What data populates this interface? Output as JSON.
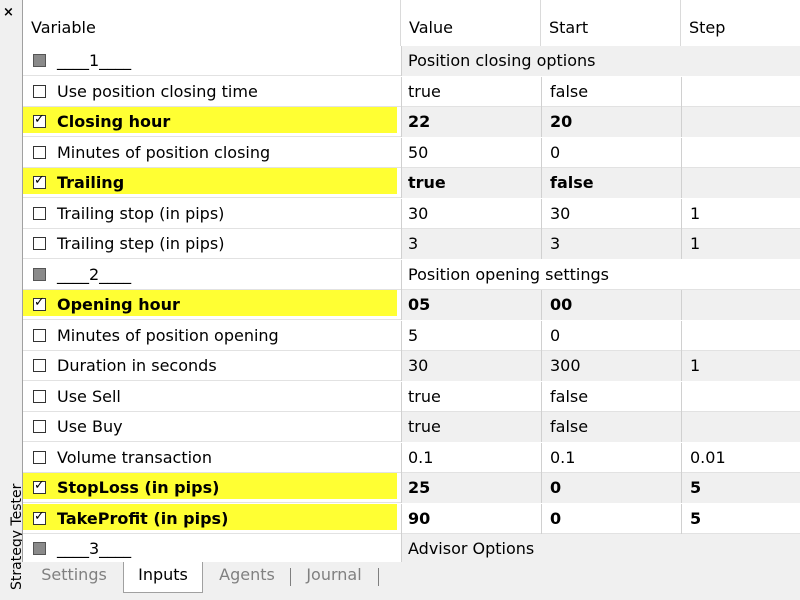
{
  "window": {
    "side_title": "Strategy Tester",
    "close_glyph": "×"
  },
  "columns": [
    "Variable",
    "Value",
    "Start",
    "Step"
  ],
  "rows": [
    {
      "label": "____1____",
      "value": "Position closing options",
      "start": "",
      "step": "",
      "type": "section"
    },
    {
      "label": "Use position closing time",
      "value": "true",
      "start": "false",
      "step": "",
      "checked": false
    },
    {
      "label": "Closing hour",
      "value": "22",
      "start": "20",
      "step": "",
      "checked": true
    },
    {
      "label": "Minutes of position closing",
      "value": "50",
      "start": "0",
      "step": "",
      "checked": false
    },
    {
      "label": "Trailing",
      "value": "true",
      "start": "false",
      "step": "",
      "checked": true
    },
    {
      "label": "Trailing stop (in pips)",
      "value": "30",
      "start": "30",
      "step": "1",
      "checked": false
    },
    {
      "label": "Trailing step (in pips)",
      "value": "3",
      "start": "3",
      "step": "1",
      "checked": false
    },
    {
      "label": "____2____",
      "value": "Position opening settings",
      "start": "",
      "step": "",
      "type": "section"
    },
    {
      "label": "Opening hour",
      "value": "05",
      "start": "00",
      "step": "",
      "checked": true
    },
    {
      "label": "Minutes of position opening",
      "value": "5",
      "start": "0",
      "step": "",
      "checked": false
    },
    {
      "label": "Duration in seconds",
      "value": "30",
      "start": "300",
      "step": "1",
      "checked": false
    },
    {
      "label": "Use Sell",
      "value": "true",
      "start": "false",
      "step": "",
      "checked": false
    },
    {
      "label": "Use Buy",
      "value": "true",
      "start": "false",
      "step": "",
      "checked": false
    },
    {
      "label": "Volume transaction",
      "value": "0.1",
      "start": "0.1",
      "step": "0.01",
      "checked": false
    },
    {
      "label": "StopLoss (in pips)",
      "value": "25",
      "start": "0",
      "step": "5",
      "checked": true
    },
    {
      "label": "TakeProfit (in pips)",
      "value": "90",
      "start": "0",
      "step": "5",
      "checked": true
    },
    {
      "label": "____3____",
      "value": "Advisor Options",
      "start": "",
      "step": "",
      "type": "section"
    }
  ],
  "tabs": [
    {
      "label": "Settings",
      "active": false
    },
    {
      "label": "Inputs",
      "active": true
    },
    {
      "label": "Agents",
      "active": false
    },
    {
      "label": "Journal",
      "active": false
    }
  ],
  "colors": {
    "highlight": "#ffff33",
    "alt_row": "#f0f0f0"
  }
}
